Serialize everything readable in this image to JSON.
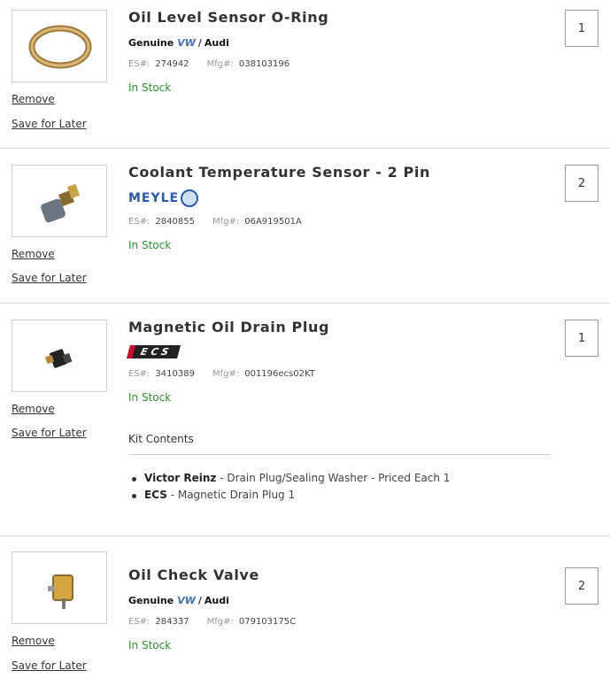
{
  "items": [
    {
      "title": "Oil Level Sensor O-Ring",
      "brand": {
        "type": "genuine",
        "genuine_label": "Genuine",
        "vw_label": "VW",
        "sep": "/",
        "audi_label": "Audi"
      },
      "es_label": "ES#:",
      "es_value": "274942",
      "mfg_label": "Mfg#:",
      "mfg_value": "038103196",
      "stock": "In Stock",
      "qty": "1",
      "remove_label": "Remove",
      "save_label": "Save for Later",
      "image_icon": "o-ring-image"
    },
    {
      "title": "Coolant Temperature Sensor - 2 Pin",
      "brand": {
        "type": "meyle",
        "label": "MEYLE"
      },
      "es_label": "ES#:",
      "es_value": "2840855",
      "mfg_label": "Mfg#:",
      "mfg_value": "06A919501A",
      "stock": "In Stock",
      "qty": "2",
      "remove_label": "Remove",
      "save_label": "Save for Later",
      "image_icon": "sensor-image"
    },
    {
      "title": "Magnetic Oil Drain Plug",
      "brand": {
        "type": "ecs",
        "label": "ECS"
      },
      "es_label": "ES#:",
      "es_value": "3410389",
      "mfg_label": "Mfg#:",
      "mfg_value": "001196ecs02KT",
      "stock": "In Stock",
      "qty": "1",
      "remove_label": "Remove",
      "save_label": "Save for Later",
      "image_icon": "drain-plug-image",
      "kit": {
        "title": "Kit Contents",
        "entries": [
          {
            "brand": "Victor Reinz",
            "desc": " - Drain Plug/Sealing Washer - Priced Each 1"
          },
          {
            "brand": "ECS",
            "desc": " - Magnetic Drain Plug 1"
          }
        ]
      }
    },
    {
      "title": "Oil Check Valve",
      "brand": {
        "type": "genuine",
        "genuine_label": "Genuine",
        "vw_label": "VW",
        "sep": "/",
        "audi_label": "Audi"
      },
      "es_label": "ES#:",
      "es_value": "284337",
      "mfg_label": "Mfg#:",
      "mfg_value": "079103175C",
      "stock": "In Stock",
      "qty": "2",
      "remove_label": "Remove",
      "save_label": "Save for Later",
      "image_icon": "check-valve-image"
    }
  ],
  "colors": {
    "stock": "#2f8f2f",
    "vw_blue": "#3d6fb0",
    "meyle_blue": "#2a5aa8",
    "ecs_red": "#c8102e"
  }
}
